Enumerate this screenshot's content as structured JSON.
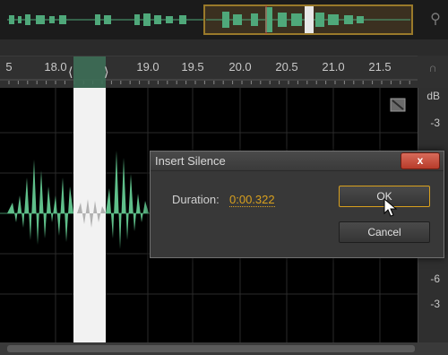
{
  "ruler": {
    "ticks": [
      "5",
      "18.0",
      "19.0",
      "19.5",
      "20.0",
      "20.5",
      "21.0",
      "21.5"
    ]
  },
  "db_scale": {
    "labels": [
      "dB",
      "-3",
      "-6",
      "-3"
    ]
  },
  "dialog": {
    "title": "Insert Silence",
    "close_label": "x",
    "duration_label": "Duration:",
    "duration_value": "0:00.322",
    "ok_label": "OK",
    "cancel_label": "Cancel"
  },
  "icons": {
    "zoom": "magnifier-icon",
    "headphones": "headphones-icon",
    "close": "close-icon",
    "cursor": "pointer-cursor-icon",
    "corner": "waveform-corner-icon"
  },
  "colors": {
    "waveform": "#5fbf8a",
    "selection": "#f2f2f2",
    "accent": "#d8a01e",
    "close_button": "#c24a38"
  }
}
